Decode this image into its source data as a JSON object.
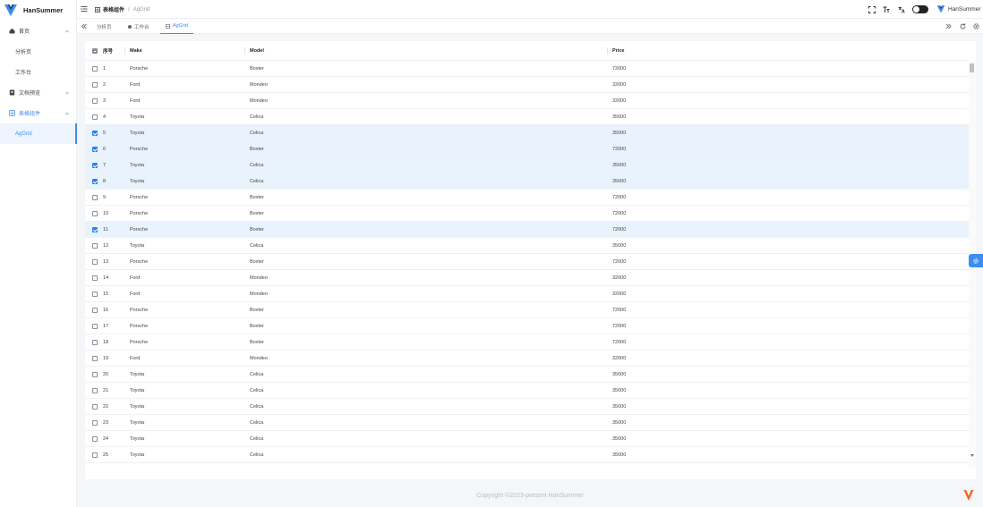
{
  "app": {
    "name": "HanSummer"
  },
  "header": {
    "breadcrumb": [
      "表格组件",
      "AgGrid"
    ],
    "user_name": "HanSummer",
    "icons": [
      "fullscreen-icon",
      "font-size-icon",
      "translate-icon",
      "theme-toggle"
    ]
  },
  "sidebar": {
    "items": [
      {
        "label": "首页",
        "icon": "home-icon",
        "level": 1,
        "expanded": true
      },
      {
        "label": "分析页",
        "level": 2
      },
      {
        "label": "工作台",
        "level": 2
      },
      {
        "label": "文档预览",
        "icon": "document-icon",
        "level": 1,
        "expanded": false
      },
      {
        "label": "表格组件",
        "icon": "table-icon",
        "level": 1,
        "expanded": true,
        "active_parent": true
      },
      {
        "label": "AgGrid",
        "level": 2,
        "active": true
      }
    ]
  },
  "tabs": [
    {
      "label": "分析页"
    },
    {
      "label": "工作台",
      "icon": "dot-icon"
    },
    {
      "label": "AgGrid",
      "icon": "table-icon",
      "active": true
    }
  ],
  "grid": {
    "columns": [
      "序号",
      "Make",
      "Model",
      "Price"
    ],
    "header_checkbox": "indeterminate",
    "rows": [
      {
        "no": "1",
        "make": "Porsche",
        "model": "Boxter",
        "price": "72000",
        "selected": false
      },
      {
        "no": "2",
        "make": "Ford",
        "model": "Mondeo",
        "price": "32000",
        "selected": false
      },
      {
        "no": "3",
        "make": "Ford",
        "model": "Mondeo",
        "price": "32000",
        "selected": false
      },
      {
        "no": "4",
        "make": "Toyota",
        "model": "Celica",
        "price": "35000",
        "selected": false
      },
      {
        "no": "5",
        "make": "Toyota",
        "model": "Celica",
        "price": "35000",
        "selected": true
      },
      {
        "no": "6",
        "make": "Porsche",
        "model": "Boxter",
        "price": "72000",
        "selected": true
      },
      {
        "no": "7",
        "make": "Toyota",
        "model": "Celica",
        "price": "35000",
        "selected": true
      },
      {
        "no": "8",
        "make": "Toyota",
        "model": "Celica",
        "price": "35000",
        "selected": true
      },
      {
        "no": "9",
        "make": "Porsche",
        "model": "Boxter",
        "price": "72000",
        "selected": false
      },
      {
        "no": "10",
        "make": "Porsche",
        "model": "Boxter",
        "price": "72000",
        "selected": false
      },
      {
        "no": "11",
        "make": "Porsche",
        "model": "Boxter",
        "price": "72000",
        "selected": true
      },
      {
        "no": "12",
        "make": "Toyota",
        "model": "Celica",
        "price": "35000",
        "selected": false
      },
      {
        "no": "13",
        "make": "Porsche",
        "model": "Boxter",
        "price": "72000",
        "selected": false
      },
      {
        "no": "14",
        "make": "Ford",
        "model": "Mondeo",
        "price": "32000",
        "selected": false
      },
      {
        "no": "15",
        "make": "Ford",
        "model": "Mondeo",
        "price": "32000",
        "selected": false
      },
      {
        "no": "16",
        "make": "Porsche",
        "model": "Boxter",
        "price": "72000",
        "selected": false
      },
      {
        "no": "17",
        "make": "Porsche",
        "model": "Boxter",
        "price": "72000",
        "selected": false
      },
      {
        "no": "18",
        "make": "Porsche",
        "model": "Boxter",
        "price": "72000",
        "selected": false
      },
      {
        "no": "19",
        "make": "Ford",
        "model": "Mondeo",
        "price": "32000",
        "selected": false
      },
      {
        "no": "20",
        "make": "Toyota",
        "model": "Celica",
        "price": "35000",
        "selected": false
      },
      {
        "no": "21",
        "make": "Toyota",
        "model": "Celica",
        "price": "35000",
        "selected": false
      },
      {
        "no": "22",
        "make": "Toyota",
        "model": "Celica",
        "price": "35000",
        "selected": false
      },
      {
        "no": "23",
        "make": "Toyota",
        "model": "Celica",
        "price": "35000",
        "selected": false
      },
      {
        "no": "24",
        "make": "Toyota",
        "model": "Celica",
        "price": "35000",
        "selected": false
      },
      {
        "no": "25",
        "make": "Toyota",
        "model": "Celica",
        "price": "35000",
        "selected": false
      }
    ]
  },
  "footer": {
    "text": "Copyright ©2023-present HanSummer"
  },
  "colors": {
    "accent": "#3d8cf0",
    "selected_row": "#e9f3fd",
    "checkbox_checked": "#2f80ed"
  }
}
